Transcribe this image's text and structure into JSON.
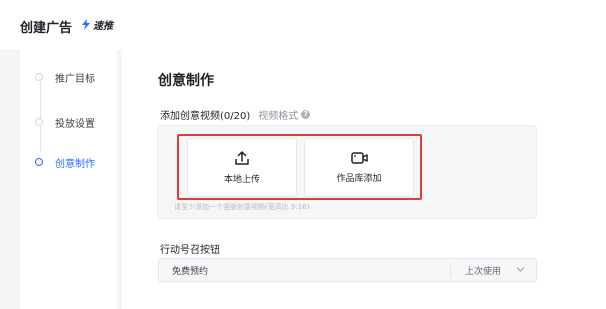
{
  "header": {
    "title": "创建广告",
    "brand": "速推"
  },
  "sidebar": {
    "steps": [
      {
        "label": "推广目标",
        "active": false
      },
      {
        "label": "投放设置",
        "active": false
      },
      {
        "label": "创意制作",
        "active": true
      }
    ]
  },
  "main": {
    "section_title": "创意制作",
    "add_video_label": "添加创意视频(0/20)",
    "video_format_link": "视频格式",
    "upload_options": [
      {
        "label": "本地上传",
        "icon": "upload-icon"
      },
      {
        "label": "作品库添加",
        "icon": "video-camera-icon"
      }
    ],
    "upload_hint": "请至少添加一个竖版创意视频(宽高比 9:16)",
    "cta_label": "行动号召按钮",
    "cta_value": "免费预约",
    "cta_recent": "上次使用"
  },
  "colors": {
    "accent": "#2d6bff",
    "highlight": "#e53935",
    "panel": "#f5f6f8"
  }
}
